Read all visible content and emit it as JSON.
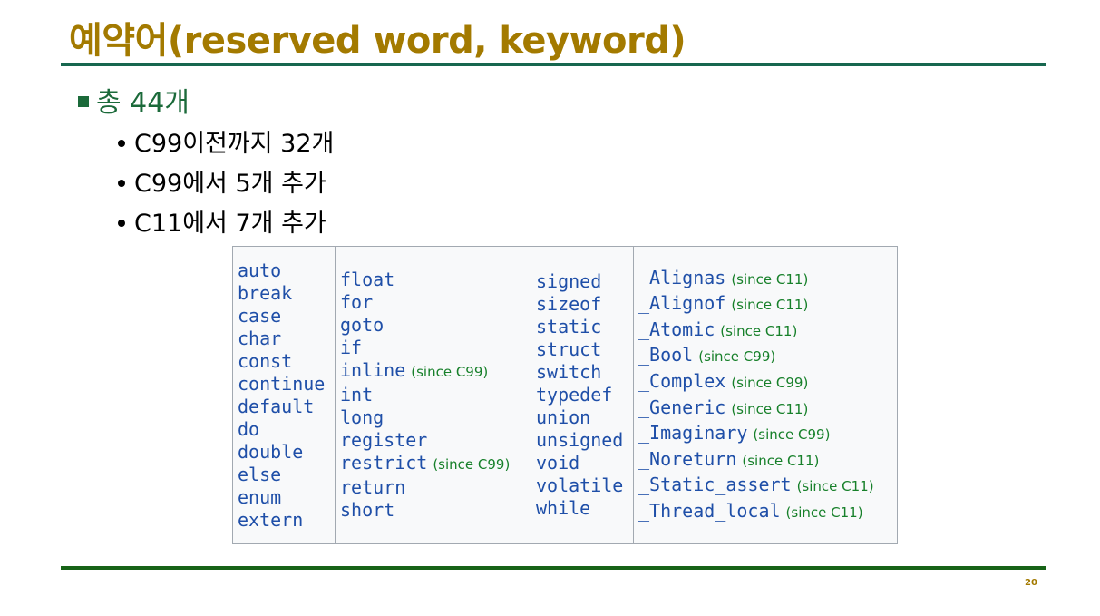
{
  "slide": {
    "title": "예약어(reserved word, keyword)",
    "main_bullet": "총 44개",
    "sub_bullets": [
      "C99이전까지 32개",
      "C99에서 5개 추가",
      "C11에서 7개 추가"
    ],
    "page_number": "20"
  },
  "table": {
    "col1": [
      {
        "kw": "auto"
      },
      {
        "kw": "break"
      },
      {
        "kw": "case"
      },
      {
        "kw": "char"
      },
      {
        "kw": "const"
      },
      {
        "kw": "continue"
      },
      {
        "kw": "default"
      },
      {
        "kw": "do"
      },
      {
        "kw": "double"
      },
      {
        "kw": "else"
      },
      {
        "kw": "enum"
      },
      {
        "kw": "extern"
      }
    ],
    "col2": [
      {
        "kw": "float"
      },
      {
        "kw": "for"
      },
      {
        "kw": "goto"
      },
      {
        "kw": "if"
      },
      {
        "kw": "inline",
        "note": "(since C99)"
      },
      {
        "kw": "int"
      },
      {
        "kw": "long"
      },
      {
        "kw": "register"
      },
      {
        "kw": "restrict",
        "note": "(since C99)"
      },
      {
        "kw": "return"
      },
      {
        "kw": "short"
      }
    ],
    "col3": [
      {
        "kw": "signed"
      },
      {
        "kw": "sizeof"
      },
      {
        "kw": "static"
      },
      {
        "kw": "struct"
      },
      {
        "kw": "switch"
      },
      {
        "kw": "typedef"
      },
      {
        "kw": "union"
      },
      {
        "kw": "unsigned"
      },
      {
        "kw": "void"
      },
      {
        "kw": "volatile"
      },
      {
        "kw": "while"
      }
    ],
    "col4": [
      {
        "kw": "_Alignas",
        "note": "(since C11)"
      },
      {
        "kw": "_Alignof",
        "note": "(since C11)"
      },
      {
        "kw": "_Atomic",
        "note": "(since C11)"
      },
      {
        "kw": "_Bool",
        "note": "(since C99)"
      },
      {
        "kw": "_Complex",
        "note": "(since C99)"
      },
      {
        "kw": "_Generic",
        "note": "(since C11)"
      },
      {
        "kw": "_Imaginary",
        "note": "(since C99)"
      },
      {
        "kw": "_Noreturn",
        "note": "(since C11)"
      },
      {
        "kw": "_Static_assert",
        "note": "(since C11)"
      },
      {
        "kw": "_Thread_local",
        "note": "(since C11)"
      }
    ]
  }
}
